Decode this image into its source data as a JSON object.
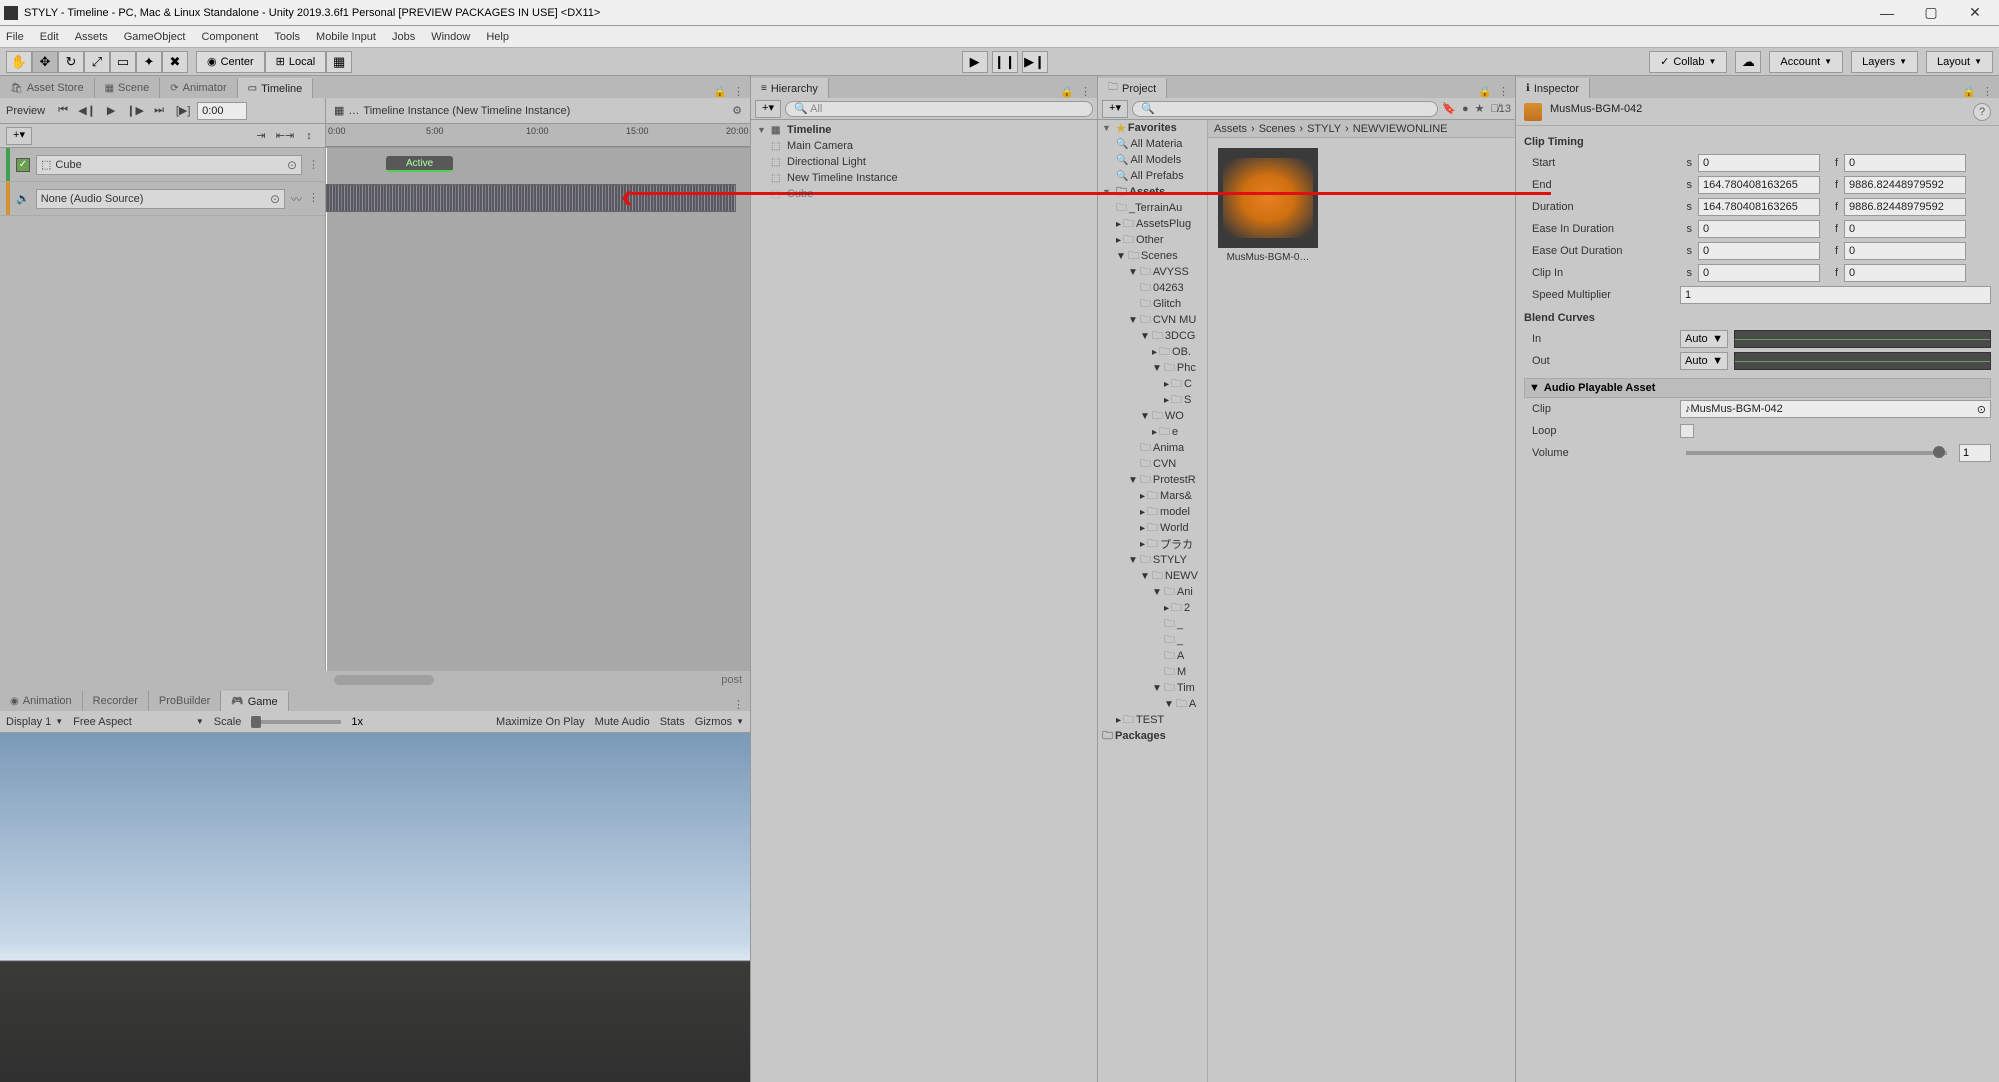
{
  "window": {
    "title": "STYLY - Timeline - PC, Mac & Linux Standalone - Unity 2019.3.6f1 Personal [PREVIEW PACKAGES IN USE] <DX11>"
  },
  "menu": [
    "File",
    "Edit",
    "Assets",
    "GameObject",
    "Component",
    "Tools",
    "Mobile Input",
    "Jobs",
    "Window",
    "Help"
  ],
  "toolbar": {
    "pivot_center": "Center",
    "pivot_local": "Local",
    "collab": "Collab",
    "account": "Account",
    "layers": "Layers",
    "layout": "Layout"
  },
  "tabs_left": {
    "asset_store": "Asset Store",
    "scene": "Scene",
    "animator": "Animator",
    "timeline": "Timeline"
  },
  "timeline": {
    "preview": "Preview",
    "time_value": "0:00",
    "instance_label": "Timeline Instance (New Timeline Instance)",
    "ruler": [
      "0:00",
      "5:00",
      "10:00",
      "15:00",
      "20:00"
    ],
    "track_cube": "Cube",
    "track_audio": "None (Audio Source)",
    "active_label": "Active"
  },
  "bottom_tabs": {
    "animation": "Animation",
    "recorder": "Recorder",
    "probuilder": "ProBuilder",
    "game": "Game"
  },
  "game_toolbar": {
    "display": "Display 1",
    "aspect": "Free Aspect",
    "scale": "Scale",
    "scale_val": "1x",
    "maximize": "Maximize On Play",
    "mute": "Mute Audio",
    "stats": "Stats",
    "gizmos": "Gizmos"
  },
  "hierarchy": {
    "title": "Hierarchy",
    "search_ph": "All",
    "root": "Timeline",
    "items": [
      "Main Camera",
      "Directional Light",
      "New Timeline Instance",
      "Cube"
    ]
  },
  "project": {
    "title": "Project",
    "hidden_count": "13",
    "breadcrumb": [
      "Assets",
      "Scenes",
      "STYLY",
      "NEWVIEWONLINE"
    ],
    "favorites": "Favorites",
    "fav_items": [
      "All Materia",
      "All Models",
      "All Prefabs"
    ],
    "assets": "Assets",
    "tree": [
      "_TerrainAu",
      "AssetsPlug",
      "Other",
      "Scenes",
      "AVYSS",
      "04263",
      "Glitch",
      "CVN MU",
      "3DCG",
      "OB.",
      "Phc",
      "C",
      "S",
      "WO",
      "e",
      "Anima",
      "CVN",
      "ProtestR",
      "Mars&",
      "model",
      "World",
      "プラカ",
      "STYLY",
      "NEWV",
      "Ani",
      "2",
      "_",
      "_",
      "A",
      "M",
      "Tim",
      "A",
      "TEST",
      "Packages"
    ],
    "asset_name": "MusMus-BGM-0…"
  },
  "inspector": {
    "title": "Inspector",
    "asset_title": "MusMus-BGM-042",
    "clip_timing": "Clip Timing",
    "start": "Start",
    "start_s": "0",
    "start_f": "0",
    "end": "End",
    "end_s": "164.780408163265",
    "end_f": "9886.82448979592",
    "duration": "Duration",
    "dur_s": "164.780408163265",
    "dur_f": "9886.82448979592",
    "ease_in": "Ease In Duration",
    "ease_in_s": "0",
    "ease_in_f": "0",
    "ease_out": "Ease Out Duration",
    "ease_out_s": "0",
    "ease_out_f": "0",
    "clip_in": "Clip In",
    "clip_in_s": "0",
    "clip_in_f": "0",
    "speed": "Speed Multiplier",
    "speed_val": "1",
    "blend": "Blend Curves",
    "in": "In",
    "out": "Out",
    "auto": "Auto",
    "playable": "Audio Playable Asset",
    "clip": "Clip",
    "clip_val": "MusMus-BGM-042",
    "loop": "Loop",
    "volume": "Volume",
    "volume_val": "1",
    "s": "s",
    "f": "f"
  }
}
